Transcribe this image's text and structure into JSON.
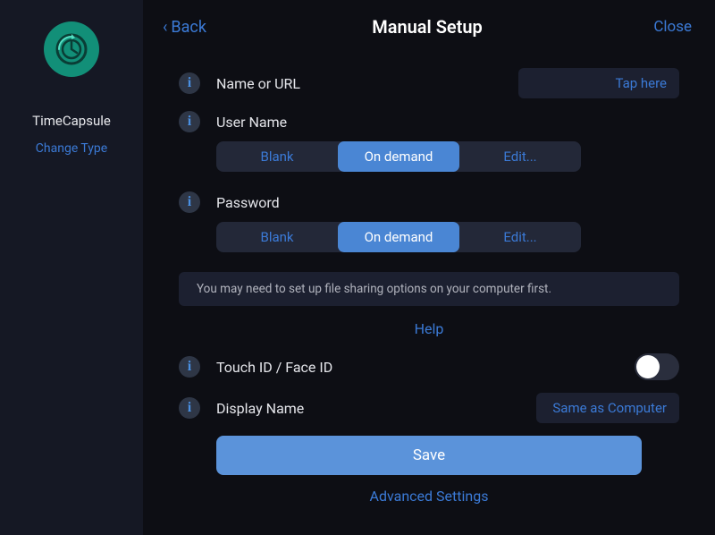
{
  "sidebar": {
    "title": "TimeCapsule",
    "change_type": "Change Type"
  },
  "header": {
    "back": "Back",
    "title": "Manual Setup",
    "close": "Close"
  },
  "fields": {
    "name_url": {
      "label": "Name or URL",
      "placeholder": "Tap here"
    },
    "username": {
      "label": "User Name",
      "options": {
        "blank": "Blank",
        "on_demand": "On demand",
        "edit": "Edit..."
      },
      "selected": "on_demand"
    },
    "password": {
      "label": "Password",
      "options": {
        "blank": "Blank",
        "on_demand": "On demand",
        "edit": "Edit..."
      },
      "selected": "on_demand"
    },
    "touch_face": {
      "label": "Touch ID / Face ID",
      "value": false
    },
    "display_name": {
      "label": "Display Name",
      "placeholder": "Same as Computer"
    }
  },
  "note": "You may need to set up file sharing options on your computer first.",
  "help": "Help",
  "save": "Save",
  "advanced": "Advanced Settings",
  "info_glyph": "i"
}
